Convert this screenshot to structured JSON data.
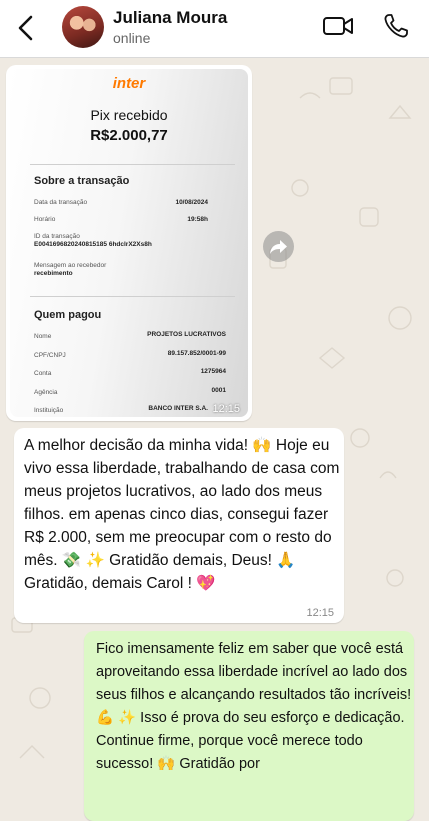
{
  "header": {
    "contact_name": "Juliana Moura",
    "status": "online"
  },
  "image_message": {
    "brand": "inter",
    "title": "Pix recebido",
    "amount": "R$2.000,77",
    "section_transaction": "Sobre a transação",
    "rows_transaction": [
      {
        "label": "Data da transação",
        "value": "10/08/2024"
      },
      {
        "label": "Horário",
        "value": "19:58h"
      },
      {
        "label": "ID da transação",
        "value": "E0041696820240815185 6hdclrX2Xs8h"
      },
      {
        "label": "Mensagem ao recebedor",
        "value": "recebimento"
      }
    ],
    "section_payer": "Quem pagou",
    "rows_payer": [
      {
        "label": "Nome",
        "value": "PROJETOS LUCRATIVOS"
      },
      {
        "label": "CPF/CNPJ",
        "value": "89.157.852/0001-99"
      },
      {
        "label": "Conta",
        "value": "1275964"
      },
      {
        "label": "Agência",
        "value": "0001"
      },
      {
        "label": "Instituição",
        "value": "BANCO INTER S.A."
      }
    ],
    "time": "12:15"
  },
  "incoming_message": {
    "text": "A melhor decisão da minha vida! 🙌 Hoje eu vivo essa liberdade, trabalhando de casa com meus projetos lucrativos, ao lado dos meus filhos. em apenas cinco dias, consegui fazer R$ 2.000, sem me preocupar com o resto do mês. 💸 ✨ Gratidão demais, Deus! 🙏 Gratidão, demais Carol ! 💖",
    "time": "12:15"
  },
  "outgoing_message": {
    "text": "Fico imensamente feliz em saber que você está aproveitando essa liberdade incrível ao lado dos seus filhos e alcançando resultados tão incríveis! 💪 ✨ Isso é prova do seu esforço e dedicação. Continue firme, porque você merece todo sucesso! 🙌 Gratidão por"
  },
  "colors": {
    "chat_background": "#efeae2",
    "incoming_bubble": "#ffffff",
    "outgoing_bubble": "#dcf8c6",
    "inter_orange": "#ff7a00"
  }
}
